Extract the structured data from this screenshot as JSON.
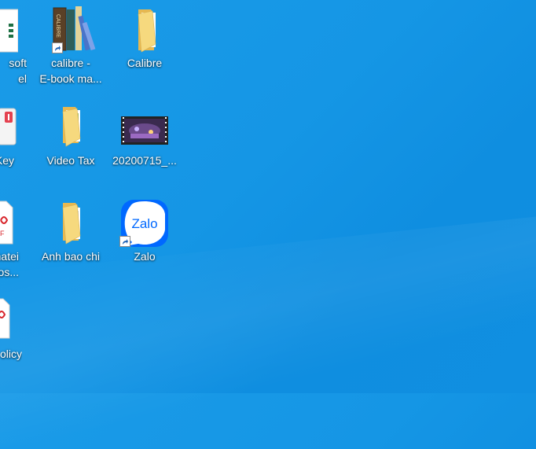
{
  "desktop": {
    "icons": [
      {
        "label_line1": "soft",
        "label_line2": "el"
      },
      {
        "label_line1": "calibre -",
        "label_line2": "E-book ma..."
      },
      {
        "label_line1": "Calibre",
        "label_line2": ""
      },
      {
        "label_line1": "Key",
        "label_line2": ""
      },
      {
        "label_line1": "Video Tax",
        "label_line2": ""
      },
      {
        "label_line1": "20200715_...",
        "label_line2": ""
      },
      {
        "label_line1": "phatei",
        "label_line2": "spos..."
      },
      {
        "label_line1": "Anh bao chi",
        "label_line2": ""
      },
      {
        "label_line1": "Zalo",
        "label_line2": ""
      },
      {
        "label_line1": "olicy",
        "label_line2": ""
      }
    ],
    "zalo_logo_text": "Zalo",
    "calibre_spine_text": "CALIBRE"
  },
  "colors": {
    "wallpaper": "#1596e5",
    "folder": "#f3d37a",
    "zalo": "#0068ff"
  }
}
